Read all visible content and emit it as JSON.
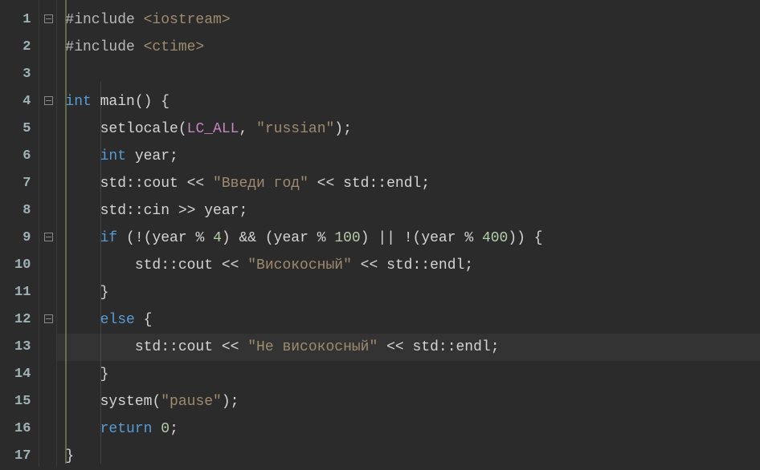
{
  "editor": {
    "gutter": [
      "1",
      "2",
      "3",
      "4",
      "5",
      "6",
      "7",
      "8",
      "9",
      "10",
      "11",
      "12",
      "13",
      "14",
      "15",
      "16",
      "17"
    ],
    "fold_markers": {
      "1": true,
      "4": true,
      "9": true,
      "12": true
    },
    "highlighted_line": 13,
    "lines": [
      [
        {
          "t": "#include ",
          "c": "tok-pre"
        },
        {
          "t": "<iostream>",
          "c": "tok-str"
        }
      ],
      [
        {
          "t": "#include ",
          "c": "tok-pre"
        },
        {
          "t": "<ctime>",
          "c": "tok-str"
        }
      ],
      [],
      [
        {
          "t": "int",
          "c": "tok-type"
        },
        {
          "t": " ",
          "c": "tok-id"
        },
        {
          "t": "main",
          "c": "tok-fn"
        },
        {
          "t": "() {",
          "c": "tok-pun"
        }
      ],
      [
        {
          "t": "    ",
          "c": "tok-pun"
        },
        {
          "t": "setlocale",
          "c": "tok-fn"
        },
        {
          "t": "(",
          "c": "tok-pun"
        },
        {
          "t": "LC_ALL",
          "c": "tok-const"
        },
        {
          "t": ", ",
          "c": "tok-pun"
        },
        {
          "t": "\"russian\"",
          "c": "tok-str"
        },
        {
          "t": ");",
          "c": "tok-pun"
        }
      ],
      [
        {
          "t": "    ",
          "c": "tok-pun"
        },
        {
          "t": "int",
          "c": "tok-type"
        },
        {
          "t": " year;",
          "c": "tok-id"
        }
      ],
      [
        {
          "t": "    std::cout << ",
          "c": "tok-id"
        },
        {
          "t": "\"Введи год\"",
          "c": "tok-str"
        },
        {
          "t": " << std::endl;",
          "c": "tok-id"
        }
      ],
      [
        {
          "t": "    std::cin >> year;",
          "c": "tok-id"
        }
      ],
      [
        {
          "t": "    ",
          "c": "tok-pun"
        },
        {
          "t": "if",
          "c": "tok-kw"
        },
        {
          "t": " (!(year % ",
          "c": "tok-id"
        },
        {
          "t": "4",
          "c": "tok-num"
        },
        {
          "t": ") && (year % ",
          "c": "tok-id"
        },
        {
          "t": "100",
          "c": "tok-num"
        },
        {
          "t": ") || !(year % ",
          "c": "tok-id"
        },
        {
          "t": "400",
          "c": "tok-num"
        },
        {
          "t": ")) {",
          "c": "tok-pun"
        }
      ],
      [
        {
          "t": "        std::cout << ",
          "c": "tok-id"
        },
        {
          "t": "\"Високосный\"",
          "c": "tok-str"
        },
        {
          "t": " << std::endl;",
          "c": "tok-id"
        }
      ],
      [
        {
          "t": "    }",
          "c": "tok-pun"
        }
      ],
      [
        {
          "t": "    ",
          "c": "tok-pun"
        },
        {
          "t": "else",
          "c": "tok-kw"
        },
        {
          "t": " {",
          "c": "tok-pun"
        }
      ],
      [
        {
          "t": "        std::cout << ",
          "c": "tok-id"
        },
        {
          "t": "\"Не високосный\"",
          "c": "tok-str"
        },
        {
          "t": " << std::endl;",
          "c": "tok-id"
        }
      ],
      [
        {
          "t": "    }",
          "c": "tok-pun"
        }
      ],
      [
        {
          "t": "    ",
          "c": "tok-pun"
        },
        {
          "t": "system",
          "c": "tok-fn"
        },
        {
          "t": "(",
          "c": "tok-pun"
        },
        {
          "t": "\"pause\"",
          "c": "tok-str"
        },
        {
          "t": ");",
          "c": "tok-pun"
        }
      ],
      [
        {
          "t": "    ",
          "c": "tok-pun"
        },
        {
          "t": "return",
          "c": "tok-kw"
        },
        {
          "t": " ",
          "c": "tok-id"
        },
        {
          "t": "0",
          "c": "tok-num"
        },
        {
          "t": ";",
          "c": "tok-pun"
        }
      ],
      [
        {
          "t": "}",
          "c": "tok-pun"
        }
      ]
    ]
  }
}
